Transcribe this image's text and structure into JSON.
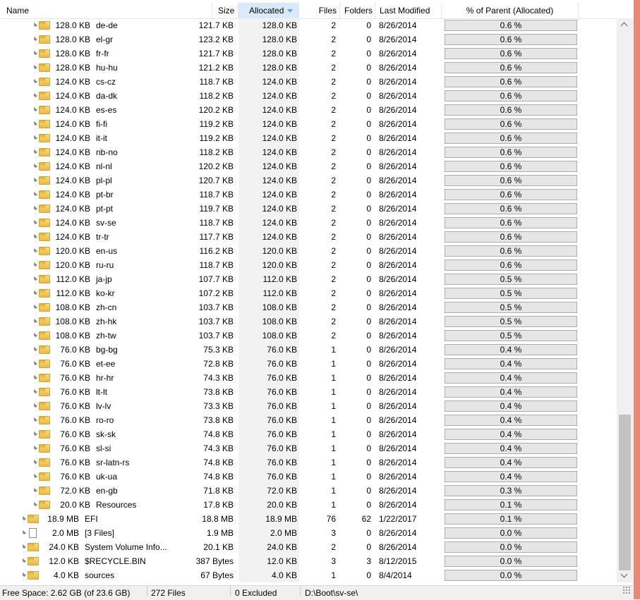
{
  "columns": {
    "name": "Name",
    "size": "Size",
    "allocated": "Allocated",
    "files": "Files",
    "folders": "Folders",
    "modified": "Last Modified",
    "pct": "% of Parent (Allocated)"
  },
  "rows": [
    {
      "indent": 1,
      "type": "folder",
      "prefix": "128.0 KB",
      "name": "de-de",
      "size": "121.7 KB",
      "alloc": "128.0 KB",
      "files": "2",
      "folders": "0",
      "modified": "8/26/2014",
      "pct": "0.6 %"
    },
    {
      "indent": 1,
      "type": "folder",
      "prefix": "128.0 KB",
      "name": "el-gr",
      "size": "123.2 KB",
      "alloc": "128.0 KB",
      "files": "2",
      "folders": "0",
      "modified": "8/26/2014",
      "pct": "0.6 %"
    },
    {
      "indent": 1,
      "type": "folder",
      "prefix": "128.0 KB",
      "name": "fr-fr",
      "size": "121.7 KB",
      "alloc": "128.0 KB",
      "files": "2",
      "folders": "0",
      "modified": "8/26/2014",
      "pct": "0.6 %"
    },
    {
      "indent": 1,
      "type": "folder",
      "prefix": "128.0 KB",
      "name": "hu-hu",
      "size": "121.2 KB",
      "alloc": "128.0 KB",
      "files": "2",
      "folders": "0",
      "modified": "8/26/2014",
      "pct": "0.6 %"
    },
    {
      "indent": 1,
      "type": "folder",
      "prefix": "124.0 KB",
      "name": "cs-cz",
      "size": "118.7 KB",
      "alloc": "124.0 KB",
      "files": "2",
      "folders": "0",
      "modified": "8/26/2014",
      "pct": "0.6 %"
    },
    {
      "indent": 1,
      "type": "folder",
      "prefix": "124.0 KB",
      "name": "da-dk",
      "size": "118.2 KB",
      "alloc": "124.0 KB",
      "files": "2",
      "folders": "0",
      "modified": "8/26/2014",
      "pct": "0.6 %"
    },
    {
      "indent": 1,
      "type": "folder",
      "prefix": "124.0 KB",
      "name": "es-es",
      "size": "120.2 KB",
      "alloc": "124.0 KB",
      "files": "2",
      "folders": "0",
      "modified": "8/26/2014",
      "pct": "0.6 %"
    },
    {
      "indent": 1,
      "type": "folder",
      "prefix": "124.0 KB",
      "name": "fi-fi",
      "size": "119.2 KB",
      "alloc": "124.0 KB",
      "files": "2",
      "folders": "0",
      "modified": "8/26/2014",
      "pct": "0.6 %"
    },
    {
      "indent": 1,
      "type": "folder",
      "prefix": "124.0 KB",
      "name": "it-it",
      "size": "119.2 KB",
      "alloc": "124.0 KB",
      "files": "2",
      "folders": "0",
      "modified": "8/26/2014",
      "pct": "0.6 %"
    },
    {
      "indent": 1,
      "type": "folder",
      "prefix": "124.0 KB",
      "name": "nb-no",
      "size": "118.2 KB",
      "alloc": "124.0 KB",
      "files": "2",
      "folders": "0",
      "modified": "8/26/2014",
      "pct": "0.6 %"
    },
    {
      "indent": 1,
      "type": "folder",
      "prefix": "124.0 KB",
      "name": "nl-nl",
      "size": "120.2 KB",
      "alloc": "124.0 KB",
      "files": "2",
      "folders": "0",
      "modified": "8/26/2014",
      "pct": "0.6 %"
    },
    {
      "indent": 1,
      "type": "folder",
      "prefix": "124.0 KB",
      "name": "pl-pl",
      "size": "120.7 KB",
      "alloc": "124.0 KB",
      "files": "2",
      "folders": "0",
      "modified": "8/26/2014",
      "pct": "0.6 %"
    },
    {
      "indent": 1,
      "type": "folder",
      "prefix": "124.0 KB",
      "name": "pt-br",
      "size": "118.7 KB",
      "alloc": "124.0 KB",
      "files": "2",
      "folders": "0",
      "modified": "8/26/2014",
      "pct": "0.6 %"
    },
    {
      "indent": 1,
      "type": "folder",
      "prefix": "124.0 KB",
      "name": "pt-pt",
      "size": "119.7 KB",
      "alloc": "124.0 KB",
      "files": "2",
      "folders": "0",
      "modified": "8/26/2014",
      "pct": "0.6 %"
    },
    {
      "indent": 1,
      "type": "folder",
      "prefix": "124.0 KB",
      "name": "sv-se",
      "size": "118.7 KB",
      "alloc": "124.0 KB",
      "files": "2",
      "folders": "0",
      "modified": "8/26/2014",
      "pct": "0.6 %"
    },
    {
      "indent": 1,
      "type": "folder",
      "prefix": "124.0 KB",
      "name": "tr-tr",
      "size": "117.7 KB",
      "alloc": "124.0 KB",
      "files": "2",
      "folders": "0",
      "modified": "8/26/2014",
      "pct": "0.6 %"
    },
    {
      "indent": 1,
      "type": "folder",
      "prefix": "120.0 KB",
      "name": "en-us",
      "size": "116.2 KB",
      "alloc": "120.0 KB",
      "files": "2",
      "folders": "0",
      "modified": "8/26/2014",
      "pct": "0.6 %"
    },
    {
      "indent": 1,
      "type": "folder",
      "prefix": "120.0 KB",
      "name": "ru-ru",
      "size": "118.7 KB",
      "alloc": "120.0 KB",
      "files": "2",
      "folders": "0",
      "modified": "8/26/2014",
      "pct": "0.6 %"
    },
    {
      "indent": 1,
      "type": "folder",
      "prefix": "112.0 KB",
      "name": "ja-jp",
      "size": "107.7 KB",
      "alloc": "112.0 KB",
      "files": "2",
      "folders": "0",
      "modified": "8/26/2014",
      "pct": "0.5 %"
    },
    {
      "indent": 1,
      "type": "folder",
      "prefix": "112.0 KB",
      "name": "ko-kr",
      "size": "107.2 KB",
      "alloc": "112.0 KB",
      "files": "2",
      "folders": "0",
      "modified": "8/26/2014",
      "pct": "0.5 %"
    },
    {
      "indent": 1,
      "type": "folder",
      "prefix": "108.0 KB",
      "name": "zh-cn",
      "size": "103.7 KB",
      "alloc": "108.0 KB",
      "files": "2",
      "folders": "0",
      "modified": "8/26/2014",
      "pct": "0.5 %"
    },
    {
      "indent": 1,
      "type": "folder",
      "prefix": "108.0 KB",
      "name": "zh-hk",
      "size": "103.7 KB",
      "alloc": "108.0 KB",
      "files": "2",
      "folders": "0",
      "modified": "8/26/2014",
      "pct": "0.5 %"
    },
    {
      "indent": 1,
      "type": "folder",
      "prefix": "108.0 KB",
      "name": "zh-tw",
      "size": "103.7 KB",
      "alloc": "108.0 KB",
      "files": "2",
      "folders": "0",
      "modified": "8/26/2014",
      "pct": "0.5 %"
    },
    {
      "indent": 1,
      "type": "folder",
      "prefix": "76.0 KB",
      "name": "bg-bg",
      "size": "75.3 KB",
      "alloc": "76.0 KB",
      "files": "1",
      "folders": "0",
      "modified": "8/26/2014",
      "pct": "0.4 %"
    },
    {
      "indent": 1,
      "type": "folder",
      "prefix": "76.0 KB",
      "name": "et-ee",
      "size": "72.8 KB",
      "alloc": "76.0 KB",
      "files": "1",
      "folders": "0",
      "modified": "8/26/2014",
      "pct": "0.4 %"
    },
    {
      "indent": 1,
      "type": "folder",
      "prefix": "76.0 KB",
      "name": "hr-hr",
      "size": "74.3 KB",
      "alloc": "76.0 KB",
      "files": "1",
      "folders": "0",
      "modified": "8/26/2014",
      "pct": "0.4 %"
    },
    {
      "indent": 1,
      "type": "folder",
      "prefix": "76.0 KB",
      "name": "lt-lt",
      "size": "73.8 KB",
      "alloc": "76.0 KB",
      "files": "1",
      "folders": "0",
      "modified": "8/26/2014",
      "pct": "0.4 %"
    },
    {
      "indent": 1,
      "type": "folder",
      "prefix": "76.0 KB",
      "name": "lv-lv",
      "size": "73.3 KB",
      "alloc": "76.0 KB",
      "files": "1",
      "folders": "0",
      "modified": "8/26/2014",
      "pct": "0.4 %"
    },
    {
      "indent": 1,
      "type": "folder",
      "prefix": "76.0 KB",
      "name": "ro-ro",
      "size": "73.8 KB",
      "alloc": "76.0 KB",
      "files": "1",
      "folders": "0",
      "modified": "8/26/2014",
      "pct": "0.4 %"
    },
    {
      "indent": 1,
      "type": "folder",
      "prefix": "76.0 KB",
      "name": "sk-sk",
      "size": "74.8 KB",
      "alloc": "76.0 KB",
      "files": "1",
      "folders": "0",
      "modified": "8/26/2014",
      "pct": "0.4 %"
    },
    {
      "indent": 1,
      "type": "folder",
      "prefix": "76.0 KB",
      "name": "sl-si",
      "size": "74.3 KB",
      "alloc": "76.0 KB",
      "files": "1",
      "folders": "0",
      "modified": "8/26/2014",
      "pct": "0.4 %"
    },
    {
      "indent": 1,
      "type": "folder",
      "prefix": "76.0 KB",
      "name": "sr-latn-rs",
      "size": "74.8 KB",
      "alloc": "76.0 KB",
      "files": "1",
      "folders": "0",
      "modified": "8/26/2014",
      "pct": "0.4 %"
    },
    {
      "indent": 1,
      "type": "folder",
      "prefix": "76.0 KB",
      "name": "uk-ua",
      "size": "74.8 KB",
      "alloc": "76.0 KB",
      "files": "1",
      "folders": "0",
      "modified": "8/26/2014",
      "pct": "0.4 %"
    },
    {
      "indent": 1,
      "type": "folder",
      "prefix": "72.0 KB",
      "name": "en-gb",
      "size": "71.8 KB",
      "alloc": "72.0 KB",
      "files": "1",
      "folders": "0",
      "modified": "8/26/2014",
      "pct": "0.3 %"
    },
    {
      "indent": 1,
      "type": "folder",
      "prefix": "20.0 KB",
      "name": "Resources",
      "size": "17.8 KB",
      "alloc": "20.0 KB",
      "files": "1",
      "folders": "0",
      "modified": "8/26/2014",
      "pct": "0.1 %"
    },
    {
      "indent": 0,
      "type": "folder",
      "prefix": "18.9 MB",
      "name": "EFI",
      "size": "18.8 MB",
      "alloc": "18.9 MB",
      "files": "76",
      "folders": "62",
      "modified": "1/22/2017",
      "pct": "0.1 %"
    },
    {
      "indent": 0,
      "type": "file",
      "prefix": "2.0 MB",
      "name": "[3 Files]",
      "size": "1.9 MB",
      "alloc": "2.0 MB",
      "files": "3",
      "folders": "0",
      "modified": "8/26/2014",
      "pct": "0.0 %"
    },
    {
      "indent": 0,
      "type": "folder",
      "prefix": "24.0 KB",
      "name": "System Volume Info...",
      "size": "20.1 KB",
      "alloc": "24.0 KB",
      "files": "2",
      "folders": "0",
      "modified": "8/26/2014",
      "pct": "0.0 %"
    },
    {
      "indent": 0,
      "type": "folder",
      "prefix": "12.0 KB",
      "name": "$RECYCLE.BIN",
      "size": "387 Bytes",
      "alloc": "12.0 KB",
      "files": "3",
      "folders": "3",
      "modified": "8/12/2015",
      "pct": "0.0 %"
    },
    {
      "indent": 0,
      "type": "folder",
      "prefix": "4.0 KB",
      "name": "sources",
      "size": "67 Bytes",
      "alloc": "4.0 KB",
      "files": "1",
      "folders": "0",
      "modified": "8/4/2014",
      "pct": "0.0 %"
    }
  ],
  "status": {
    "free_space": "Free Space: 2.62 GB  (of 23.6 GB)",
    "files": "272  Files",
    "excluded": "0 Excluded",
    "path": "D:\\Boot\\sv-se\\"
  },
  "colors": {
    "sorted_column_bg": "#d9ebf9",
    "allocated_column_bg": "#f2f2f2",
    "pct_bar_bg": "#e6e6e6",
    "window_accent": "#e58a78"
  }
}
